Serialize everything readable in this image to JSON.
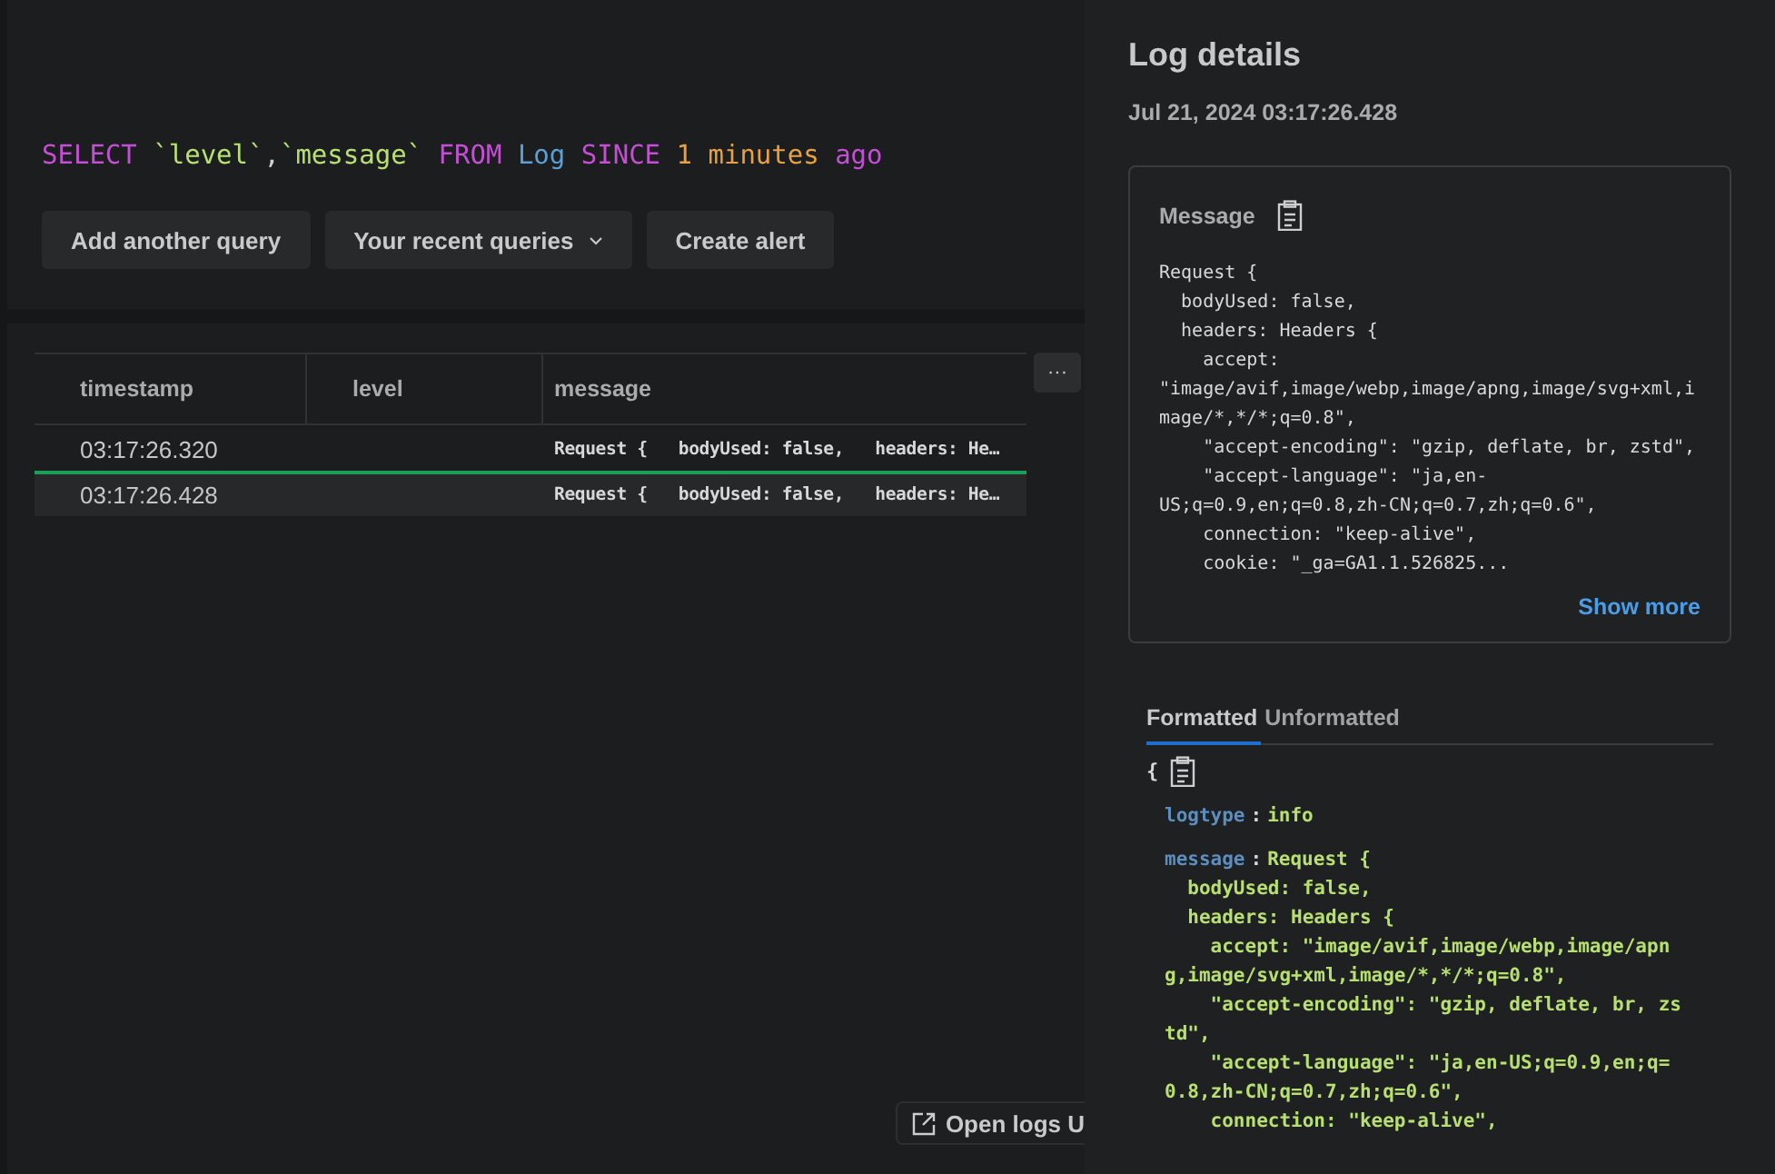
{
  "query": {
    "tokens": [
      {
        "text": "SELECT",
        "kind": "keyword"
      },
      {
        "text": "`level`",
        "kind": "field"
      },
      {
        "text": ",",
        "kind": "punct"
      },
      {
        "text": "`message`",
        "kind": "field"
      },
      {
        "text": "FROM",
        "kind": "keyword"
      },
      {
        "text": "Log",
        "kind": "table"
      },
      {
        "text": "SINCE",
        "kind": "keyword"
      },
      {
        "text": "1",
        "kind": "number"
      },
      {
        "text": "minutes",
        "kind": "number"
      },
      {
        "text": "ago",
        "kind": "keyword"
      }
    ]
  },
  "query_buttons": [
    {
      "label": "Add another query",
      "kind": "plain"
    },
    {
      "label": "Your recent queries",
      "kind": "dropdown"
    },
    {
      "label": "Create alert",
      "kind": "plain"
    }
  ],
  "table": {
    "columns": [
      "timestamp",
      "level",
      "message"
    ],
    "more_button": "···",
    "rows": [
      {
        "timestamp": "03:17:26.320",
        "level": "",
        "message": "Request {   bodyUsed: false,   headers: He…",
        "selected": false
      },
      {
        "timestamp": "03:17:26.428",
        "level": "",
        "message": "Request {   bodyUsed: false,   headers: He…",
        "selected": true
      }
    ]
  },
  "open_logs_button": "Open logs U",
  "details": {
    "title": "Log details",
    "timestamp": "Jul 21, 2024 03:17:26.428",
    "message_card": {
      "label": "Message",
      "lines": [
        "Request {",
        "  bodyUsed: false,",
        "  headers: Headers {",
        "    accept:",
        "\"image/avif,image/webp,image/apng,image/svg+xml,i",
        "mage/*,*/*;q=0.8\",",
        "    \"accept-encoding\": \"gzip, deflate, br, zstd\",",
        "    \"accept-language\": \"ja,en-",
        "US;q=0.9,en;q=0.8,zh-CN;q=0.7,zh;q=0.6\",",
        "    connection: \"keep-alive\",",
        "    cookie: \"_ga=GA1.1.526825..."
      ],
      "show_more": "Show more"
    },
    "tabs": [
      {
        "label": "Formatted",
        "selected": true
      },
      {
        "label": "Unformatted",
        "selected": false
      }
    ],
    "open_brace": "{",
    "fields": [
      {
        "key": "logtype",
        "separator": ":",
        "lines": [
          "info"
        ]
      },
      {
        "key": "message",
        "separator": ":",
        "lines": [
          "Request {",
          "  bodyUsed: false,",
          "  headers: Headers {",
          "    accept: \"image/avif,image/webp,image/apn",
          "g,image/svg+xml,image/*,*/*;q=0.8\",",
          "    \"accept-encoding\": \"gzip, deflate, br, zs",
          "td\",",
          "    \"accept-language\": \"ja,en-US;q=0.9,en;q=",
          "0.8,zh-CN;q=0.7,zh;q=0.6\",",
          "    connection: \"keep-alive\","
        ]
      }
    ]
  }
}
